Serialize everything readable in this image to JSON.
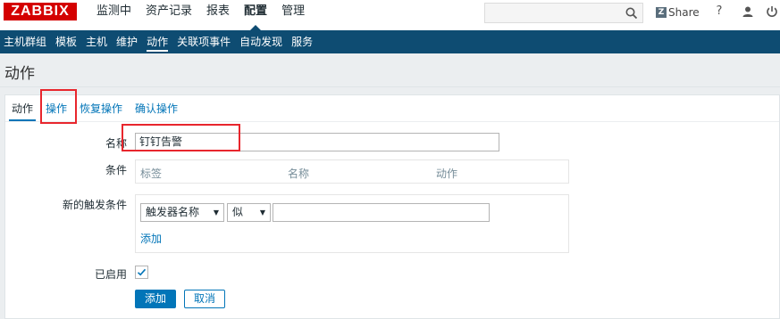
{
  "logo": "ZABBIX",
  "main_nav": [
    "监测中",
    "资产记录",
    "报表",
    "配置",
    "管理"
  ],
  "main_nav_active": "配置",
  "search": {
    "value": "",
    "placeholder": ""
  },
  "share_label": "Share",
  "help_label": "?",
  "sub_nav": [
    "主机群组",
    "模板",
    "主机",
    "维护",
    "动作",
    "关联项事件",
    "自动发现",
    "服务"
  ],
  "sub_nav_active": "动作",
  "page_title": "动作",
  "tabs": [
    {
      "label": "动作",
      "active": true
    },
    {
      "label": "操作",
      "active": false
    },
    {
      "label": "恢复操作",
      "active": false
    },
    {
      "label": "确认操作",
      "active": false
    }
  ],
  "form": {
    "name_label": "名称",
    "name_value": "钉钉告警",
    "conditions_label": "条件",
    "conditions_columns": [
      "标签",
      "名称",
      "动作"
    ],
    "new_condition_label": "新的触发条件",
    "condition_type": "触发器名称",
    "condition_operator": "似",
    "condition_value": "",
    "add_link": "添加",
    "enabled_label": "已启用",
    "enabled": true,
    "add_button": "添加",
    "cancel_button": "取消"
  },
  "colors": {
    "brand": "#d40000",
    "subnav_bg": "#0e4c72",
    "link": "#0275b8",
    "highlight": "#e8262d"
  }
}
